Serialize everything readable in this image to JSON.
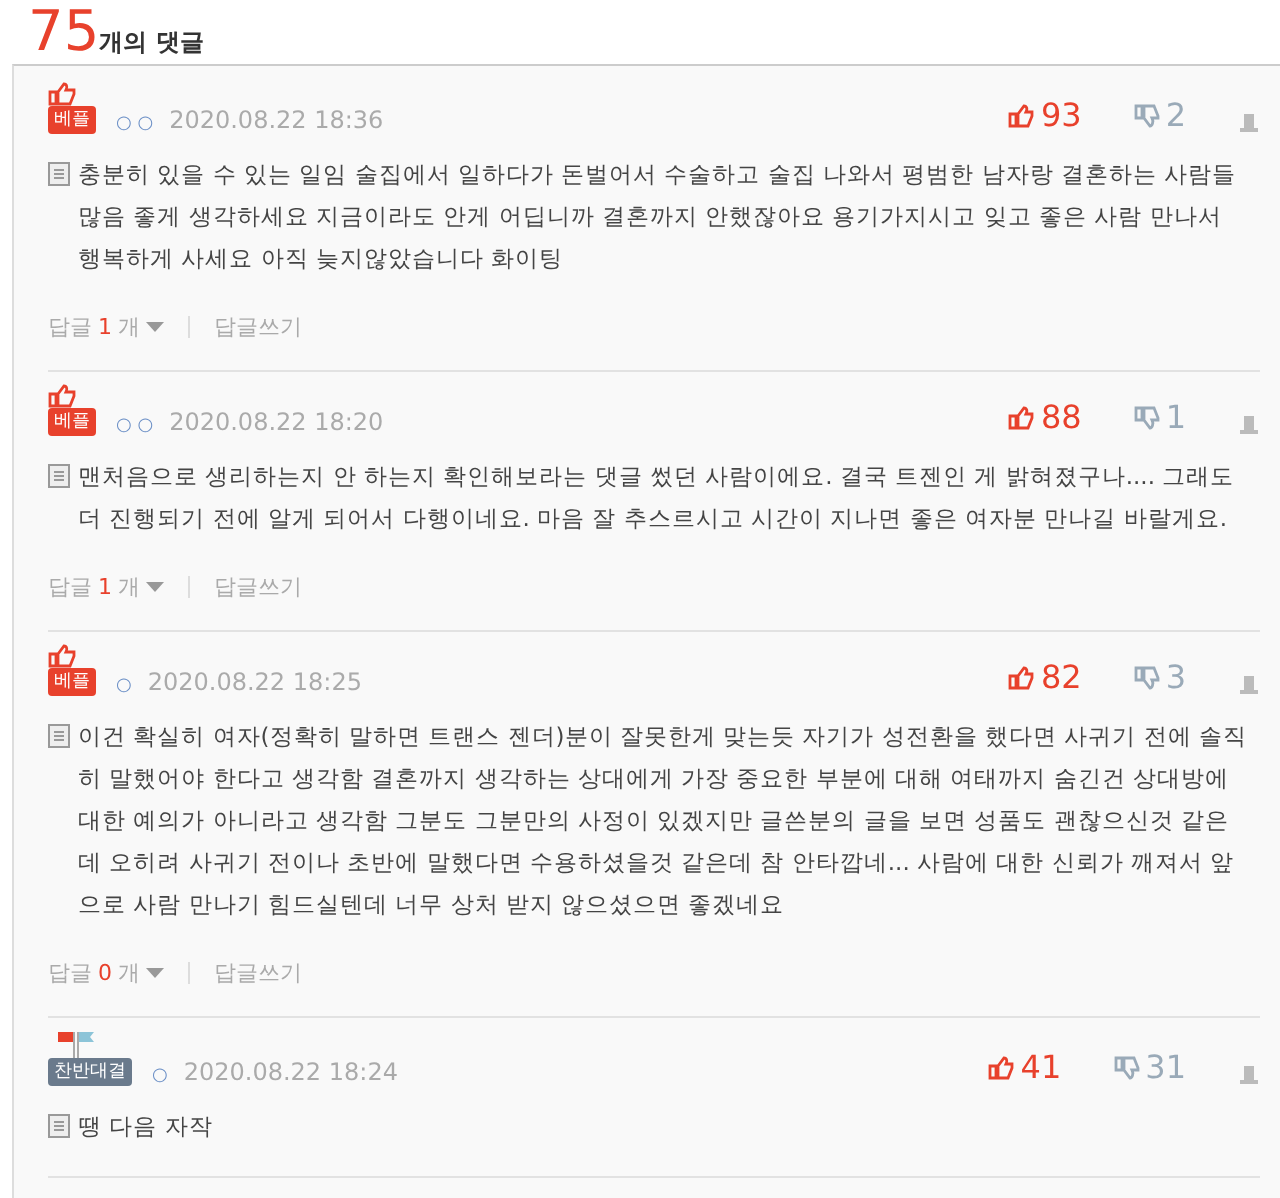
{
  "header": {
    "count": "75",
    "label": "개의 댓글"
  },
  "comments": [
    {
      "badge": {
        "kind": "best",
        "label": "베플"
      },
      "nickname": "○ ○",
      "date": "2020.08.22 18:36",
      "likes": "93",
      "dislikes": "2",
      "text": "충분히 있을 수 있는 일임 술집에서 일하다가 돈벌어서 수술하고 술집 나와서 평범한 남자랑 결혼하는 사람들 많음 좋게 생각하세요 지금이라도 안게 어딥니까 결혼까지 안했잖아요 용기가지시고 잊고 좋은 사람 만나서 행복하게 사세요 아직 늦지않았습니다 화이팅",
      "replies": {
        "label": "답글",
        "count": "1",
        "unit": "개",
        "write": "답글쓰기"
      }
    },
    {
      "badge": {
        "kind": "best",
        "label": "베플"
      },
      "nickname": "○ ○",
      "date": "2020.08.22 18:20",
      "likes": "88",
      "dislikes": "1",
      "text": "맨처음으로 생리하는지 안 하는지 확인해보라는 댓글 썼던 사람이에요. 결국 트젠인 게 밝혀졌구나.... 그래도 더 진행되기 전에 알게 되어서 다행이네요. 마음 잘 추스르시고 시간이 지나면 좋은 여자분 만나길 바랄게요.",
      "replies": {
        "label": "답글",
        "count": "1",
        "unit": "개",
        "write": "답글쓰기"
      }
    },
    {
      "badge": {
        "kind": "best",
        "label": "베플"
      },
      "nickname": "○",
      "date": "2020.08.22 18:25",
      "likes": "82",
      "dislikes": "3",
      "text": "이건 확실히 여자(정확히 말하면 트랜스 젠더)분이 잘못한게 맞는듯 자기가 성전환을 했다면 사귀기 전에 솔직히 말했어야 한다고 생각함 결혼까지 생각하는 상대에게 가장 중요한 부분에 대해 여태까지 숨긴건 상대방에 대한 예의가 아니라고 생각함 그분도 그분만의 사정이 있겠지만 글쓴분의 글을 보면 성품도 괜찮으신것 같은데 오히려 사귀기 전이나 초반에 말했다면 수용하셨을것 같은데 참 안타깝네... 사람에 대한 신뢰가 깨져서 앞으로 사람 만나기 힘드실텐데 너무 상처 받지 않으셨으면 좋겠네요",
      "replies": {
        "label": "답글",
        "count": "0",
        "unit": "개",
        "write": "답글쓰기"
      }
    },
    {
      "badge": {
        "kind": "battle",
        "label": "찬반대결"
      },
      "nickname": "○",
      "date": "2020.08.22 18:24",
      "likes": "41",
      "dislikes": "31",
      "text": "땡 다음 자작"
    }
  ]
}
